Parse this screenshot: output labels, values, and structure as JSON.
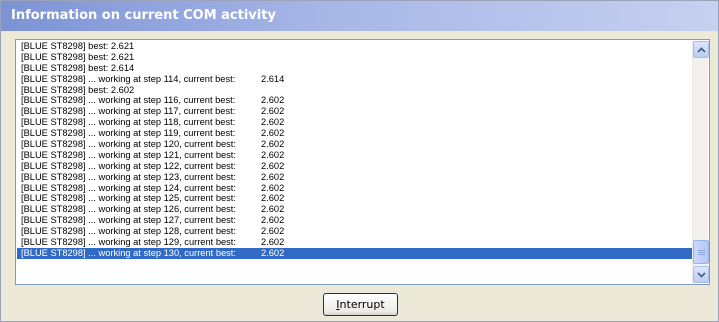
{
  "window": {
    "title": "Information on current COM activity"
  },
  "log": {
    "lines": [
      {
        "text": "[BLUE ST8298] best:  2.621",
        "value": ""
      },
      {
        "text": "[BLUE ST8298] best:  2.621",
        "value": ""
      },
      {
        "text": "[BLUE ST8298] best:  2.614",
        "value": ""
      },
      {
        "text": "[BLUE ST8298] ... working at step 114, current best:",
        "value": "2.614"
      },
      {
        "text": "[BLUE ST8298] best:  2.602",
        "value": ""
      },
      {
        "text": "[BLUE ST8298] ... working at step 116, current best:",
        "value": "2.602"
      },
      {
        "text": "[BLUE ST8298] ... working at step 117, current best:",
        "value": "2.602"
      },
      {
        "text": "[BLUE ST8298] ... working at step 118, current best:",
        "value": "2.602"
      },
      {
        "text": "[BLUE ST8298] ... working at step 119, current best:",
        "value": "2.602"
      },
      {
        "text": "[BLUE ST8298] ... working at step 120, current best:",
        "value": "2.602"
      },
      {
        "text": "[BLUE ST8298] ... working at step 121, current best:",
        "value": "2.602"
      },
      {
        "text": "[BLUE ST8298] ... working at step 122, current best:",
        "value": "2.602"
      },
      {
        "text": "[BLUE ST8298] ... working at step 123, current best:",
        "value": "2.602"
      },
      {
        "text": "[BLUE ST8298] ... working at step 124, current best:",
        "value": "2.602"
      },
      {
        "text": "[BLUE ST8298] ... working at step 125, current best:",
        "value": "2.602"
      },
      {
        "text": "[BLUE ST8298] ... working at step 126, current best:",
        "value": "2.602"
      },
      {
        "text": "[BLUE ST8298] ... working at step 127, current best:",
        "value": "2.602"
      },
      {
        "text": "[BLUE ST8298] ... working at step 128, current best:",
        "value": "2.602"
      },
      {
        "text": "[BLUE ST8298] ... working at step 129, current best:",
        "value": "2.602"
      },
      {
        "text": "[BLUE ST8298] ... working at step 130, current best:",
        "value": "2.602"
      }
    ],
    "selected_index": 19,
    "scroll_position": 0.92
  },
  "buttons": {
    "interrupt_mnemonic": "I",
    "interrupt_rest": "nterrupt"
  },
  "icons": {
    "scroll_up": "chevron-up-icon",
    "scroll_down": "chevron-down-icon"
  },
  "colors": {
    "title_bar": "#7c93d4",
    "selection": "#316ac5",
    "dialog_face": "#ece9d8"
  }
}
